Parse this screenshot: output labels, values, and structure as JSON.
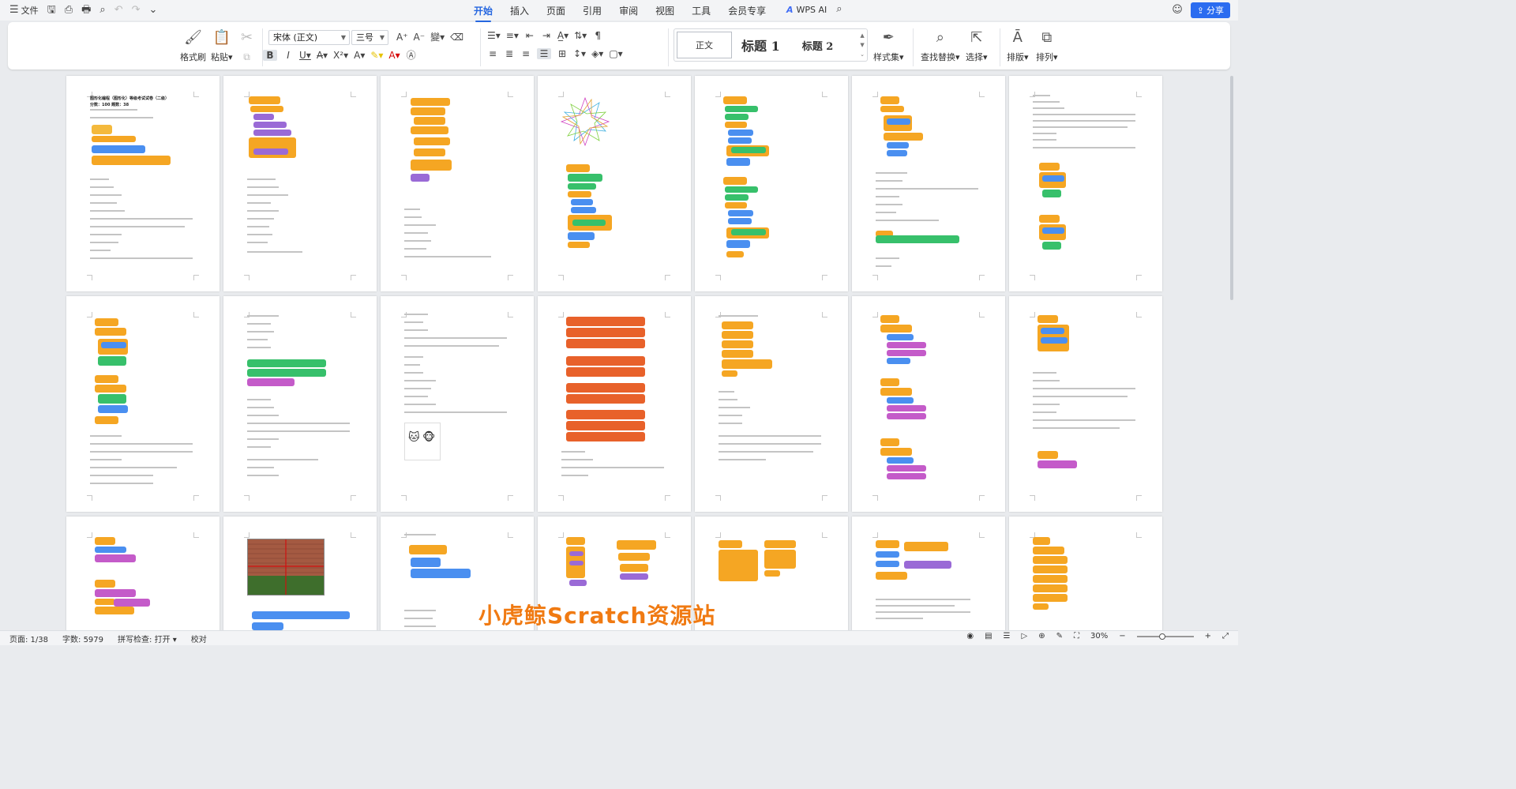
{
  "menubar": {
    "menu_icon": "hamburger-icon",
    "file_label": "文件",
    "tabs": [
      {
        "label": "开始",
        "active": true
      },
      {
        "label": "插入"
      },
      {
        "label": "页面"
      },
      {
        "label": "引用"
      },
      {
        "label": "审阅"
      },
      {
        "label": "视图"
      },
      {
        "label": "工具"
      },
      {
        "label": "会员专享"
      }
    ],
    "wps_ai_label": "WPS AI",
    "share_label": "分享"
  },
  "ribbon": {
    "format_painter": "格式刷",
    "paste": "粘贴",
    "font_name": "宋体 (正文)",
    "font_size": "三号",
    "style_normal": "正文",
    "style_h1": "标题 1",
    "style_h2": "标题 2",
    "style_set": "样式集",
    "find_replace": "查找替换",
    "select": "选择",
    "layout": "排版",
    "arrange": "排列"
  },
  "document": {
    "page1_title": "图形化编程（图形化）等级考试试卷（二级）",
    "page1_score": "分数：100    题数：38",
    "watermark": "小虎鲸Scratch资源站"
  },
  "statusbar": {
    "page": "页面: 1/38",
    "words": "字数: 5979",
    "spellcheck": "拼写检查: 打开",
    "proofread": "校对",
    "zoom": "30%",
    "zoom_level": 0.3
  },
  "colors": {
    "accent": "#2667e0",
    "share_button": "#2b6cf0",
    "watermark": "#f07a12"
  }
}
